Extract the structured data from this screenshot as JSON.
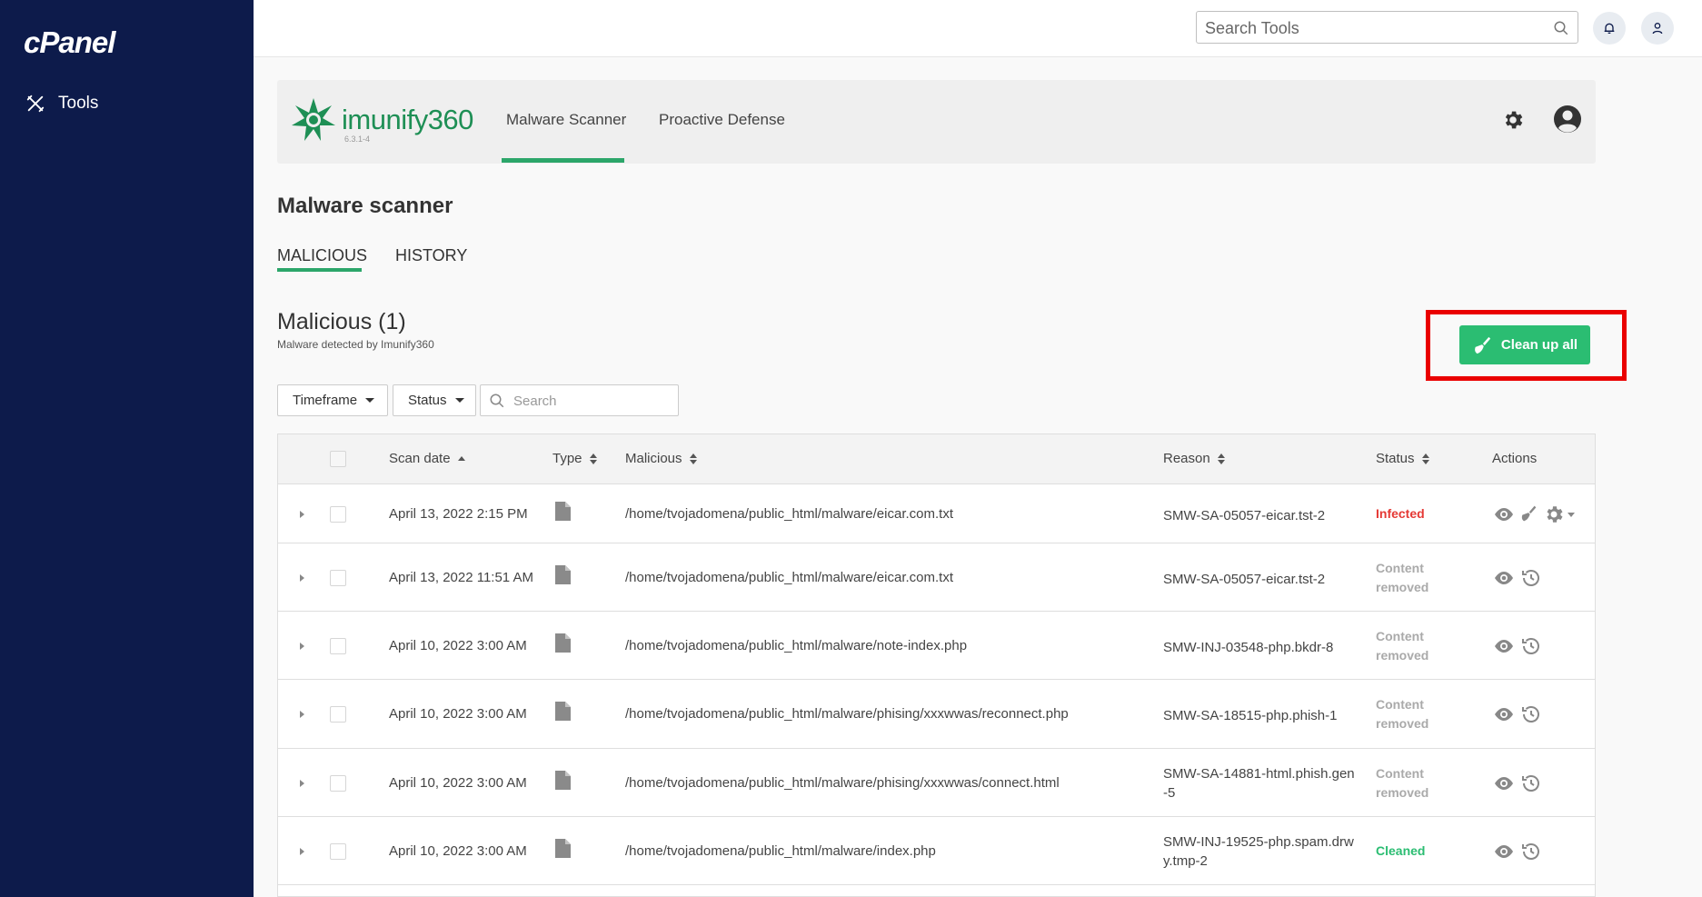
{
  "sidebar": {
    "brand": "cPanel",
    "tools_label": "Tools"
  },
  "topbar": {
    "search_placeholder": "Search Tools"
  },
  "imunify": {
    "name": "imunify360",
    "version": "6.3.1-4",
    "tabs": [
      "Malware Scanner",
      "Proactive Defense"
    ],
    "active_tab": "Malware Scanner"
  },
  "page": {
    "title": "Malware scanner",
    "subtabs": [
      "MALICIOUS",
      "HISTORY"
    ],
    "section_title": "Malicious (1)",
    "section_subtitle": "Malware detected by Imunify360",
    "cleanup_label": "Clean up all"
  },
  "filters": {
    "timeframe": "Timeframe",
    "status": "Status",
    "search_placeholder": "Search"
  },
  "table": {
    "headers": [
      "Scan date",
      "Type",
      "Malicious",
      "Reason",
      "Status",
      "Actions"
    ],
    "rows": [
      {
        "date": "April 13, 2022 2:15 PM",
        "path": "/home/tvojadomena/public_html/malware/eicar.com.txt",
        "reason": "SMW-SA-05057-eicar.tst-2",
        "status": "Infected",
        "status_kind": "infected"
      },
      {
        "date": "April 13, 2022 11:51 AM",
        "path": "/home/tvojadomena/public_html/malware/eicar.com.txt",
        "reason": "SMW-SA-05057-eicar.tst-2",
        "status": "Content removed",
        "status_kind": "removed"
      },
      {
        "date": "April 10, 2022 3:00 AM",
        "path": "/home/tvojadomena/public_html/malware/note-index.php",
        "reason": "SMW-INJ-03548-php.bkdr-8",
        "status": "Content removed",
        "status_kind": "removed"
      },
      {
        "date": "April 10, 2022 3:00 AM",
        "path": "/home/tvojadomena/public_html/malware/phising/xxxwwas/reconnect.php",
        "reason": "SMW-SA-18515-php.phish-1",
        "status": "Content removed",
        "status_kind": "removed"
      },
      {
        "date": "April 10, 2022 3:00 AM",
        "path": "/home/tvojadomena/public_html/malware/phising/xxxwwas/connect.html",
        "reason": "SMW-SA-14881-html.phish.gen-5",
        "status": "Content removed",
        "status_kind": "removed"
      },
      {
        "date": "April 10, 2022 3:00 AM",
        "path": "/home/tvojadomena/public_html/malware/index.php",
        "reason": "SMW-INJ-19525-php.spam.drwy.tmp-2",
        "status": "Cleaned",
        "status_kind": "cleaned"
      }
    ]
  },
  "colors": {
    "sidebar": "#0d1b4b",
    "accent": "#2bbd72",
    "infected": "#e53935",
    "highlight": "#ea0000"
  }
}
